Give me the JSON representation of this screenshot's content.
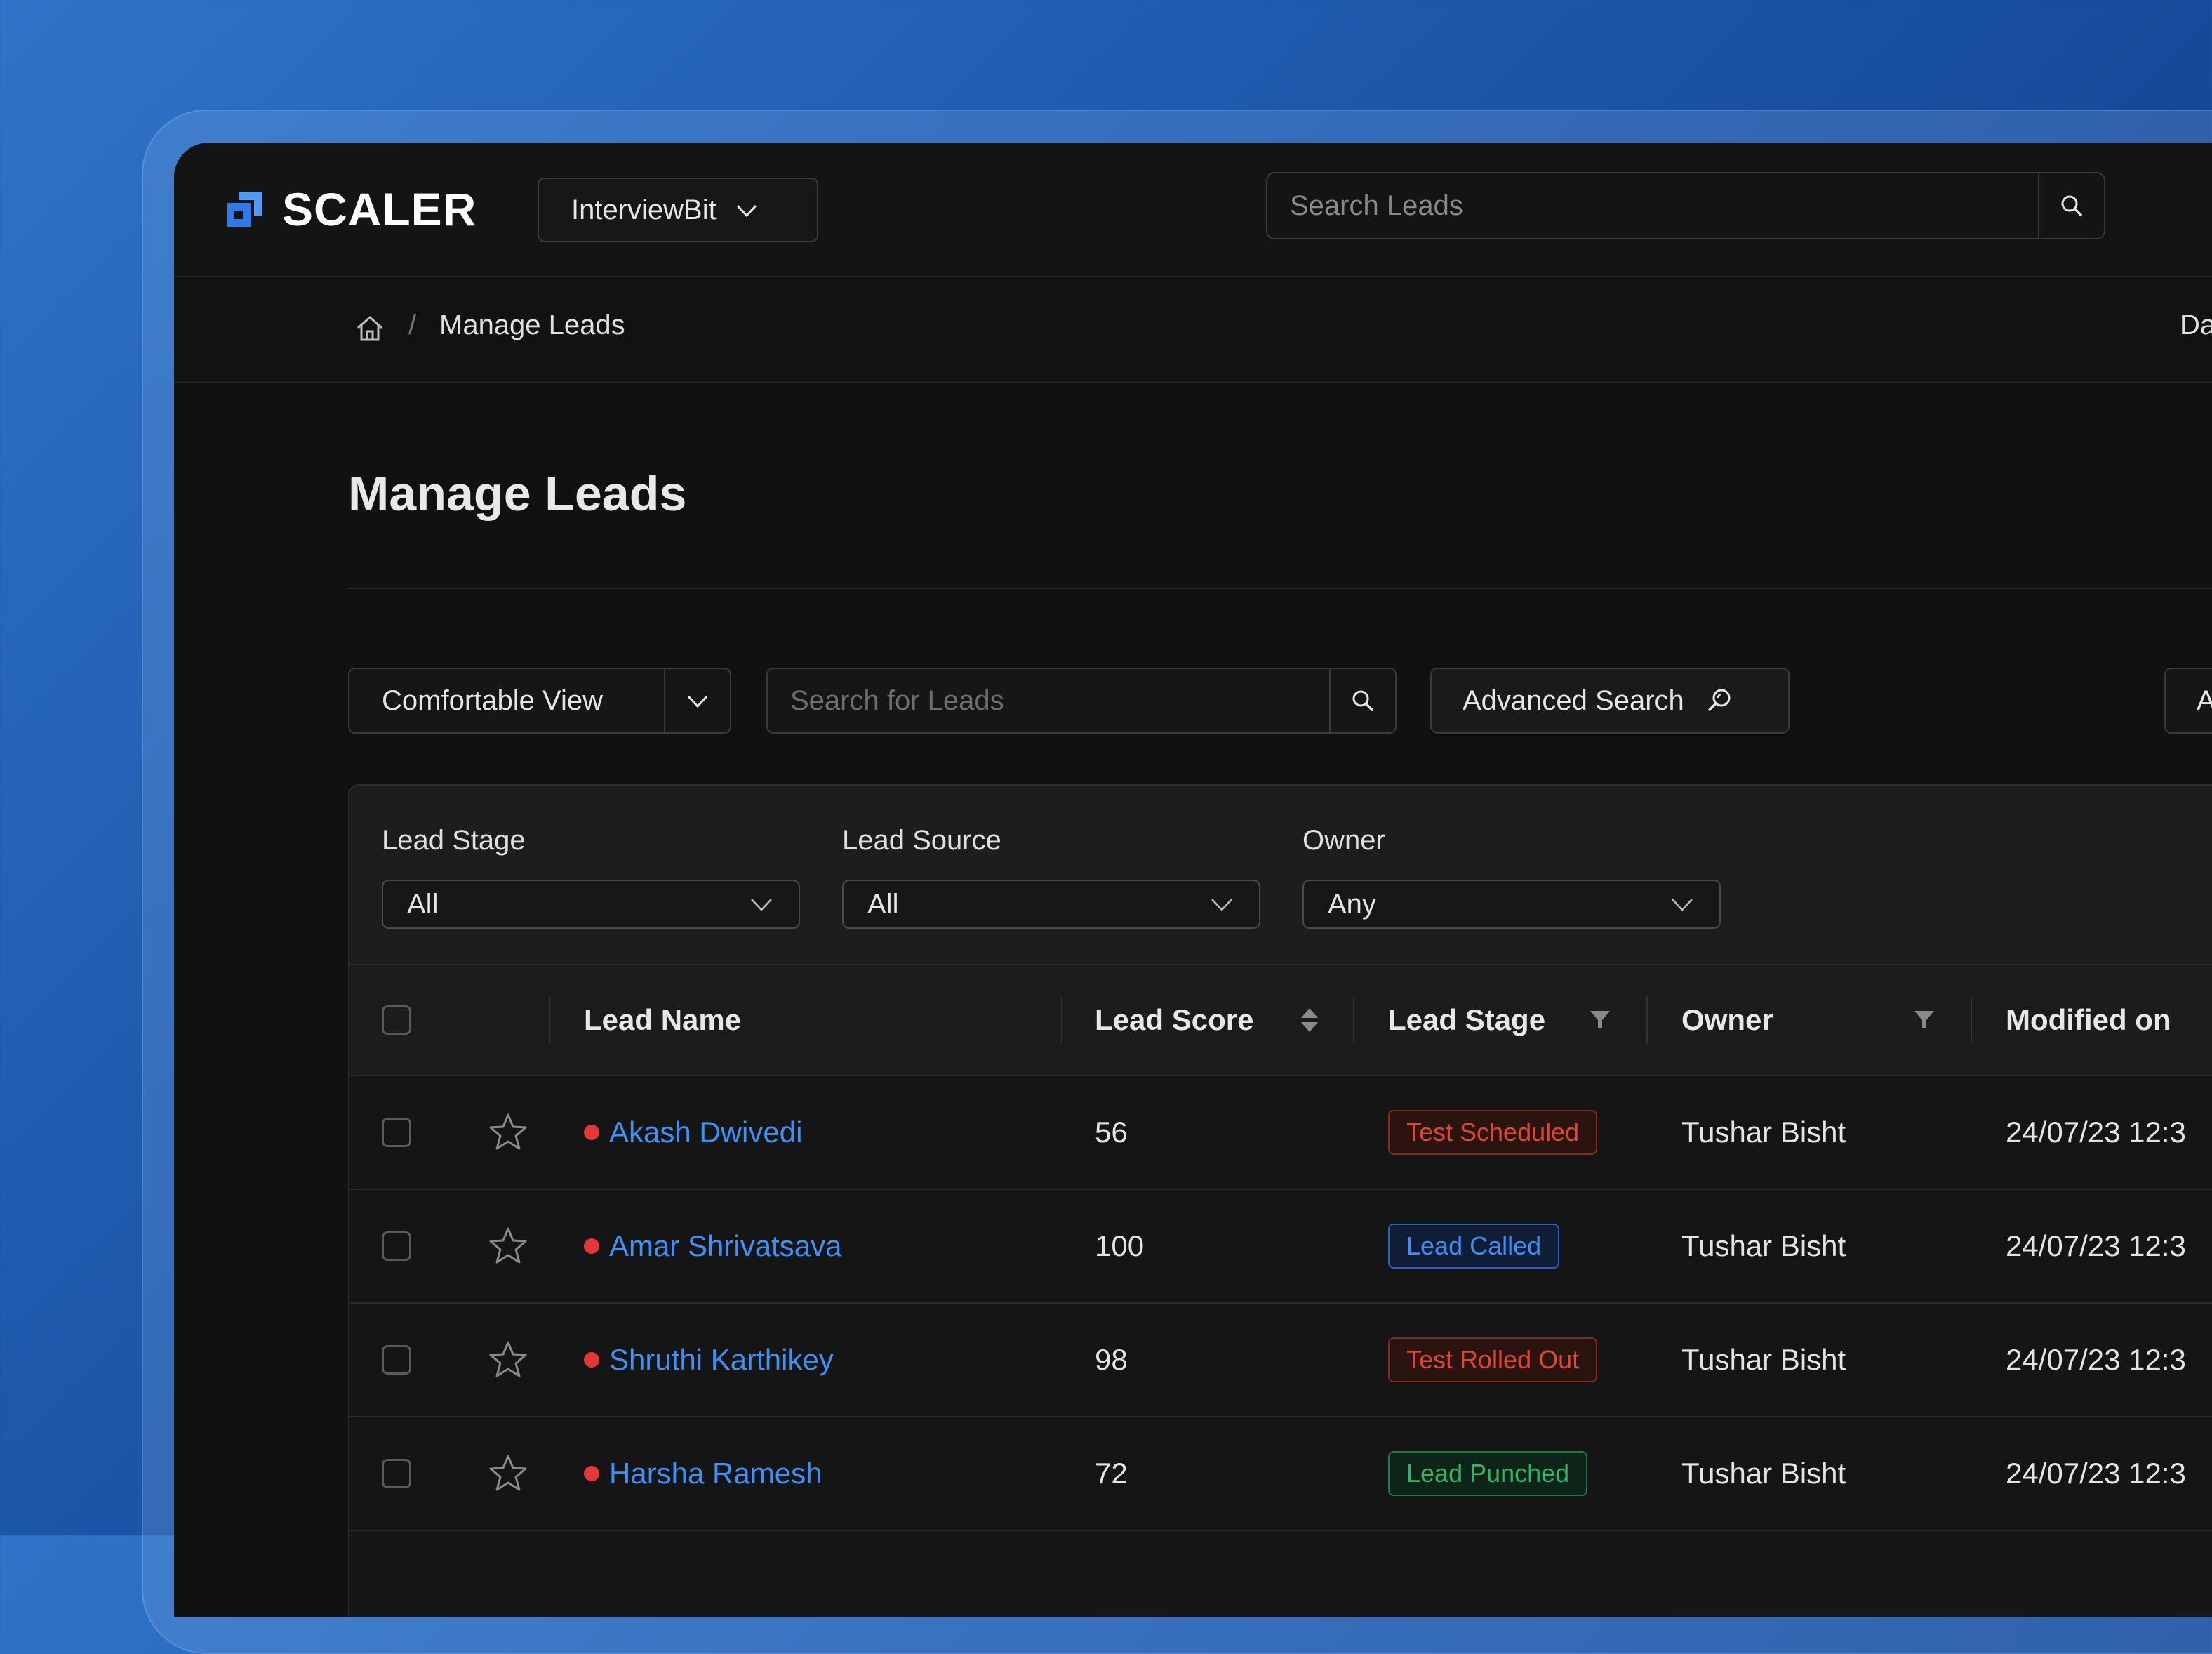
{
  "app": {
    "logo_text": "SCALER",
    "org_selector": "InterviewBit",
    "top_search_placeholder": "Search Leads"
  },
  "breadcrumb": {
    "current": "Manage Leads",
    "right_partial": "Da"
  },
  "page": {
    "title": "Manage Leads"
  },
  "toolbar": {
    "view_label": "Comfortable View",
    "search_placeholder": "Search for Leads",
    "advanced_search_label": "Advanced Search",
    "cut_button_label": "A"
  },
  "filters": [
    {
      "label": "Lead Stage",
      "value": "All"
    },
    {
      "label": "Lead Source",
      "value": "All"
    },
    {
      "label": "Owner",
      "value": "Any"
    }
  ],
  "table": {
    "columns": [
      "Lead Name",
      "Lead Score",
      "Lead Stage",
      "Owner",
      "Modified on"
    ],
    "rows": [
      {
        "name": "Akash Dwivedi",
        "score": "56",
        "stage": "Test Scheduled",
        "stage_color": "#e0472b",
        "owner": "Tushar Bisht",
        "modified": "24/07/23  12:3"
      },
      {
        "name": "Amar Shrivatsava",
        "score": "100",
        "stage": "Lead Called",
        "stage_color": "#3d8ef5",
        "owner": "Tushar Bisht",
        "modified": "24/07/23  12:3"
      },
      {
        "name": "Shruthi Karthikey",
        "score": "98",
        "stage": "Test Rolled Out",
        "stage_color": "#e0472b",
        "owner": "Tushar Bisht",
        "modified": "24/07/23  12:3"
      },
      {
        "name": "Harsha Ramesh",
        "score": "72",
        "stage": "Lead Punched",
        "stage_color": "#2fb563",
        "owner": "Tushar Bisht",
        "modified": "24/07/23  12:3"
      }
    ]
  },
  "colors": {
    "link": "#3d93f5",
    "brand_logo": "#4f9cf5",
    "status_dot": "#e5373a"
  },
  "icons": [
    "scaler-logo-icon",
    "chevron-down-icon",
    "search-icon",
    "home-icon",
    "advanced-search-icon",
    "sort-icon",
    "filter-icon",
    "star-icon"
  ]
}
